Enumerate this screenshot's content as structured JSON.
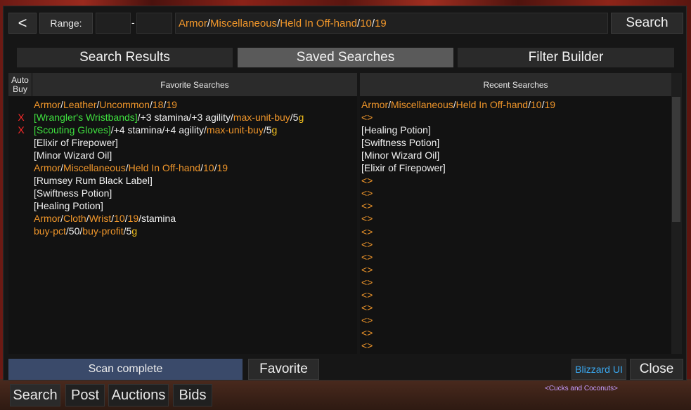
{
  "topbar": {
    "back_label": "<",
    "range_label": "Range:",
    "range_dash": "-",
    "query": [
      {
        "t": "Armor",
        "c": "orange"
      },
      {
        "t": "/",
        "c": "white"
      },
      {
        "t": "Miscellaneous",
        "c": "orange"
      },
      {
        "t": "/",
        "c": "white"
      },
      {
        "t": "Held In Off-hand",
        "c": "orange"
      },
      {
        "t": "/",
        "c": "white"
      },
      {
        "t": "10",
        "c": "orange"
      },
      {
        "t": "/",
        "c": "white"
      },
      {
        "t": "19",
        "c": "orange"
      }
    ],
    "search_label": "Search"
  },
  "tabs": [
    "Search Results",
    "Saved Searches",
    "Filter Builder"
  ],
  "active_tab": "Saved Searches",
  "favorites": {
    "autobuy_header": "Auto\nBuy",
    "header": "Favorite Searches",
    "rows": [
      {
        "x": "",
        "parts": [
          {
            "t": "Armor",
            "c": "orange"
          },
          {
            "t": "/",
            "c": "white"
          },
          {
            "t": "Leather",
            "c": "orange"
          },
          {
            "t": "/",
            "c": "white"
          },
          {
            "t": "Uncommon",
            "c": "orange"
          },
          {
            "t": "/",
            "c": "white"
          },
          {
            "t": "18",
            "c": "orange"
          },
          {
            "t": "/",
            "c": "white"
          },
          {
            "t": "19",
            "c": "orange"
          }
        ]
      },
      {
        "x": "X",
        "parts": [
          {
            "t": "[Wrangler's Wristbands]",
            "c": "green"
          },
          {
            "t": "/+3 stamina/+3 agility/",
            "c": "white"
          },
          {
            "t": "max-unit-buy",
            "c": "orange"
          },
          {
            "t": "/",
            "c": "white"
          },
          {
            "t": "5",
            "c": "white"
          },
          {
            "t": "g",
            "c": "gold"
          }
        ]
      },
      {
        "x": "X",
        "parts": [
          {
            "t": "[Scouting Gloves]",
            "c": "green"
          },
          {
            "t": "/+4 stamina/+4 agility/",
            "c": "white"
          },
          {
            "t": "max-unit-buy",
            "c": "orange"
          },
          {
            "t": "/",
            "c": "white"
          },
          {
            "t": "5",
            "c": "white"
          },
          {
            "t": "g",
            "c": "gold"
          }
        ]
      },
      {
        "x": "",
        "parts": [
          {
            "t": "[Elixir of Firepower]",
            "c": "white"
          }
        ]
      },
      {
        "x": "",
        "parts": [
          {
            "t": "[Minor Wizard Oil]",
            "c": "white"
          }
        ]
      },
      {
        "x": "",
        "parts": [
          {
            "t": "Armor",
            "c": "orange"
          },
          {
            "t": "/",
            "c": "white"
          },
          {
            "t": "Miscellaneous",
            "c": "orange"
          },
          {
            "t": "/",
            "c": "white"
          },
          {
            "t": "Held In Off-hand",
            "c": "orange"
          },
          {
            "t": "/",
            "c": "white"
          },
          {
            "t": "10",
            "c": "orange"
          },
          {
            "t": "/",
            "c": "white"
          },
          {
            "t": "19",
            "c": "orange"
          }
        ]
      },
      {
        "x": "",
        "parts": [
          {
            "t": "[Rumsey Rum Black Label]",
            "c": "white"
          }
        ]
      },
      {
        "x": "",
        "parts": [
          {
            "t": "[Swiftness Potion]",
            "c": "white"
          }
        ]
      },
      {
        "x": "",
        "parts": [
          {
            "t": "[Healing Potion]",
            "c": "white"
          }
        ]
      },
      {
        "x": "",
        "parts": [
          {
            "t": "Armor",
            "c": "orange"
          },
          {
            "t": "/",
            "c": "white"
          },
          {
            "t": "Cloth",
            "c": "orange"
          },
          {
            "t": "/",
            "c": "white"
          },
          {
            "t": "Wrist",
            "c": "orange"
          },
          {
            "t": "/",
            "c": "white"
          },
          {
            "t": "10",
            "c": "orange"
          },
          {
            "t": "/",
            "c": "white"
          },
          {
            "t": "19",
            "c": "orange"
          },
          {
            "t": "/stamina",
            "c": "white"
          }
        ]
      },
      {
        "x": "",
        "parts": [
          {
            "t": "buy-pct",
            "c": "orange"
          },
          {
            "t": "/50/",
            "c": "white"
          },
          {
            "t": "buy-profit",
            "c": "orange"
          },
          {
            "t": "/",
            "c": "white"
          },
          {
            "t": "5",
            "c": "white"
          },
          {
            "t": "g",
            "c": "gold"
          }
        ]
      }
    ]
  },
  "recent": {
    "header": "Recent Searches",
    "rows": [
      [
        {
          "t": "Armor",
          "c": "orange"
        },
        {
          "t": "/",
          "c": "white"
        },
        {
          "t": "Miscellaneous",
          "c": "orange"
        },
        {
          "t": "/",
          "c": "white"
        },
        {
          "t": "Held In Off-hand",
          "c": "orange"
        },
        {
          "t": "/",
          "c": "white"
        },
        {
          "t": "10",
          "c": "orange"
        },
        {
          "t": "/",
          "c": "white"
        },
        {
          "t": "19",
          "c": "orange"
        }
      ],
      [
        {
          "t": "<>",
          "c": "orange"
        }
      ],
      [
        {
          "t": "[Healing Potion]",
          "c": "white"
        }
      ],
      [
        {
          "t": "[Swiftness Potion]",
          "c": "white"
        }
      ],
      [
        {
          "t": "[Minor Wizard Oil]",
          "c": "white"
        }
      ],
      [
        {
          "t": "[Elixir of Firepower]",
          "c": "white"
        }
      ],
      [
        {
          "t": "<>",
          "c": "orange"
        }
      ],
      [
        {
          "t": "<>",
          "c": "orange"
        }
      ],
      [
        {
          "t": "<>",
          "c": "orange"
        }
      ],
      [
        {
          "t": "<>",
          "c": "orange"
        }
      ],
      [
        {
          "t": "<>",
          "c": "orange"
        }
      ],
      [
        {
          "t": "<>",
          "c": "orange"
        }
      ],
      [
        {
          "t": "<>",
          "c": "orange"
        }
      ],
      [
        {
          "t": "<>",
          "c": "orange"
        }
      ],
      [
        {
          "t": "<>",
          "c": "orange"
        }
      ],
      [
        {
          "t": "<>",
          "c": "orange"
        }
      ],
      [
        {
          "t": "<>",
          "c": "orange"
        }
      ],
      [
        {
          "t": "<>",
          "c": "orange"
        }
      ],
      [
        {
          "t": "<>",
          "c": "orange"
        }
      ],
      [
        {
          "t": "<>",
          "c": "orange"
        }
      ]
    ]
  },
  "status_text": "Scan complete",
  "favorite_label": "Favorite",
  "blizzard_label": "Blizzard UI",
  "close_label": "Close",
  "bottom_tabs": [
    "Search",
    "Post",
    "Auctions",
    "Bids"
  ],
  "guild_tag": "<Cucks and Coconuts>",
  "colors": {
    "orange": "#f0962a",
    "green": "#3fe03f",
    "gold": "#f4c01c",
    "close_x": "#ff2a2a",
    "blizzard": "#3aa8f0",
    "status_bg": "#3a4a6a"
  }
}
